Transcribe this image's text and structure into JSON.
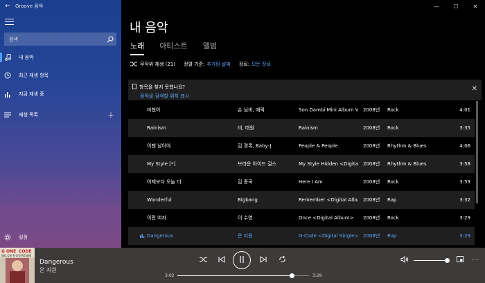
{
  "app": {
    "title": "Groove 음악"
  },
  "sidebar": {
    "search": {
      "placeholder": "검색"
    },
    "items": [
      {
        "label": "내 음악",
        "icon": "music-note-icon",
        "selected": true
      },
      {
        "label": "최근 재생 항목",
        "icon": "clock-icon",
        "selected": false
      },
      {
        "label": "지금 재생 중",
        "icon": "equalizer-icon",
        "selected": false
      },
      {
        "label": "재생 목록",
        "icon": "playlist-icon",
        "selected": false
      }
    ],
    "settings_label": "설정"
  },
  "main": {
    "page_title": "내 음악",
    "tabs": [
      {
        "label": "노래",
        "active": true
      },
      {
        "label": "아티스트",
        "active": false
      },
      {
        "label": "앨범",
        "active": false
      }
    ],
    "toolbar": {
      "shuffle_label": "무작위 재생 (21)",
      "sort_label": "정렬 기준:",
      "sort_value": "추가된 날짜",
      "genre_label": "장르:",
      "genre_value": "모든 장르"
    },
    "notice": {
      "title": "항목을 찾지 못했나요?",
      "link": "음악을 검색할 위치 표시"
    },
    "songs": [
      {
        "title": "미쳤어",
        "artist": "손 님비, 에릭",
        "album": "Son Dambi Mini Album V",
        "year": "2008년",
        "genre": "Rock",
        "duration": "4:01"
      },
      {
        "title": "Rainism",
        "artist": "비, 태원",
        "album": "Rainism",
        "year": "2008년",
        "genre": "Rock",
        "duration": "3:35"
      },
      {
        "title": "이젠 남이야",
        "artist": "김 경록, Baby-J",
        "album": "People & People",
        "year": "2008년",
        "genre": "Rhythm & Blues",
        "duration": "4:06"
      },
      {
        "title": "My Style [*]",
        "artist": "브라운 아이드 걸스",
        "album": "My Style Hidden <Digital",
        "year": "2008년",
        "genre": "Rhythm & Blues",
        "duration": "3:58"
      },
      {
        "title": "어제보다 오늘 더",
        "artist": "김 종국",
        "album": "Here I Am",
        "year": "2008년",
        "genre": "Rock",
        "duration": "3:59"
      },
      {
        "title": "Wonderful",
        "artist": "Bigbang",
        "album": "Remember <Digital Albu",
        "year": "2008년",
        "genre": "Rap",
        "duration": "3:32"
      },
      {
        "title": "이런 여자",
        "artist": "이 수영",
        "album": "Once <Digital Album>",
        "year": "2008년",
        "genre": "Rock",
        "duration": "3:29"
      },
      {
        "title": "Dangerous",
        "artist": "은 지원",
        "album": "G-Code <Digital Single>",
        "year": "2008년",
        "genre": "Rap",
        "duration": "3:29",
        "playing": true
      }
    ]
  },
  "player": {
    "now_playing_title": "Dangerous",
    "now_playing_artist": "은 지원",
    "current_time": "3:02",
    "total_time": "3:29",
    "progress_fraction": 0.87,
    "volume_fraction": 1.0
  },
  "colors": {
    "accent": "#5ea9ff",
    "player_bg": "#3d3b3a"
  }
}
